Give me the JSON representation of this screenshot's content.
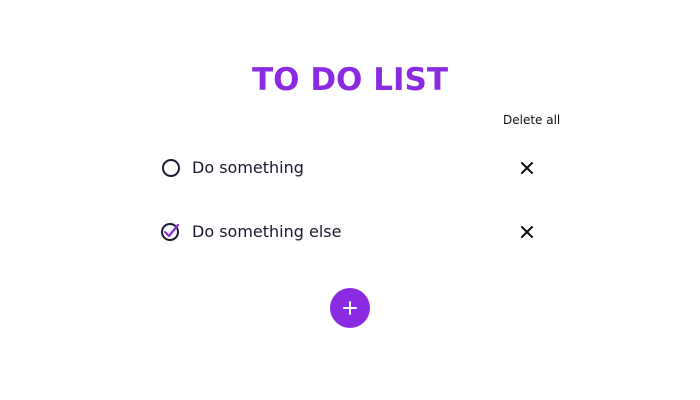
{
  "header": {
    "title": "TO DO LIST",
    "delete_all_label": "Delete all"
  },
  "todos": [
    {
      "text": "Do something",
      "done": false,
      "check_icon": "circle-unchecked-icon",
      "remove_icon": "close-icon"
    },
    {
      "text": "Do something else",
      "done": true,
      "check_icon": "circle-checked-icon",
      "remove_icon": "close-icon"
    }
  ],
  "add_button": {
    "icon": "plus-icon"
  },
  "colors": {
    "accent": "#8a2be2",
    "text": "#1a1a2e",
    "icon": "#1a1a2e",
    "background": "#ffffff"
  }
}
